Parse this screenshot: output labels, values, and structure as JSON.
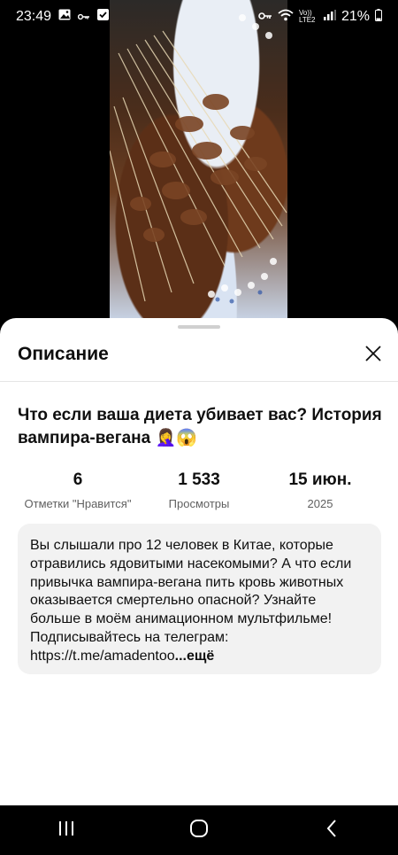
{
  "status_bar": {
    "time": "23:49",
    "battery": "21%",
    "network_label": "Vo)) LTE2",
    "icons": [
      "gallery-icon",
      "key-icon",
      "check-icon",
      "vpn-key-icon",
      "wifi-icon",
      "signal-icon",
      "battery-icon"
    ]
  },
  "sheet": {
    "title": "Описание",
    "close_icon": "close-icon"
  },
  "video": {
    "title": "Что если ваша диета убивает вас? История вампира-вегана 🤦‍♀️😱",
    "stats": [
      {
        "value": "6",
        "label": "Отметки \"Нравится\""
      },
      {
        "value": "1 533",
        "label": "Просмотры"
      },
      {
        "value": "15 июн.",
        "label": "2025"
      }
    ],
    "description": "Вы слышали про 12 человек в Китае, которые отравились ядовитыми насекомыми? А что если привычка вампира-вегана пить кровь животных оказывается смертельно опасной? Узнайте больше в моём анимационном мультфильме! Подписывайтесь на телеграм: https://t.me/amadentoo",
    "more_label": "...ещё"
  },
  "nav_bar": {
    "icons": [
      "recent-apps-icon",
      "home-icon",
      "back-icon"
    ]
  }
}
